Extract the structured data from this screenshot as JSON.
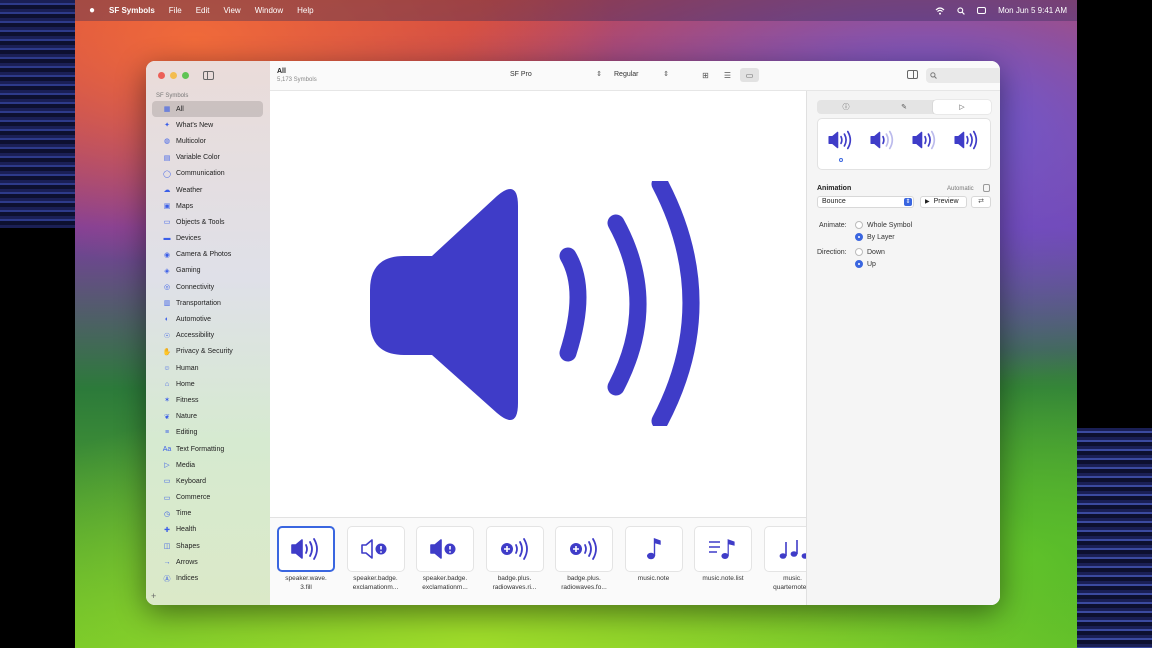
{
  "colors": {
    "accent": "#3a66e0",
    "symbol": "#3f3cc8"
  },
  "menubar": {
    "app_name": "SF Symbols",
    "menus": [
      "File",
      "Edit",
      "View",
      "Window",
      "Help"
    ],
    "clock": "Mon Jun 5  9:41 AM"
  },
  "sidebar": {
    "section": "SF Symbols",
    "items": [
      {
        "label": "All",
        "icon": "grid-icon"
      },
      {
        "label": "What's New",
        "icon": "sparkle-icon"
      },
      {
        "label": "Multicolor",
        "icon": "palette-icon"
      },
      {
        "label": "Variable Color",
        "icon": "slider-icon"
      },
      {
        "label": "Communication",
        "icon": "bubble-icon"
      },
      {
        "label": "Weather",
        "icon": "cloud-icon"
      },
      {
        "label": "Maps",
        "icon": "map-icon"
      },
      {
        "label": "Objects & Tools",
        "icon": "folder-icon"
      },
      {
        "label": "Devices",
        "icon": "display-icon"
      },
      {
        "label": "Camera & Photos",
        "icon": "camera-icon"
      },
      {
        "label": "Gaming",
        "icon": "gamecontroller-icon"
      },
      {
        "label": "Connectivity",
        "icon": "antenna-icon"
      },
      {
        "label": "Transportation",
        "icon": "car-icon"
      },
      {
        "label": "Automotive",
        "icon": "steering-icon"
      },
      {
        "label": "Accessibility",
        "icon": "accessibility-icon"
      },
      {
        "label": "Privacy & Security",
        "icon": "lock-icon"
      },
      {
        "label": "Human",
        "icon": "person-icon"
      },
      {
        "label": "Home",
        "icon": "house-icon"
      },
      {
        "label": "Fitness",
        "icon": "figure-run-icon"
      },
      {
        "label": "Nature",
        "icon": "leaf-icon"
      },
      {
        "label": "Editing",
        "icon": "slider-lines-icon"
      },
      {
        "label": "Text Formatting",
        "icon": "text-icon"
      },
      {
        "label": "Media",
        "icon": "play-icon"
      },
      {
        "label": "Keyboard",
        "icon": "keyboard-icon"
      },
      {
        "label": "Commerce",
        "icon": "cart-icon"
      },
      {
        "label": "Time",
        "icon": "clock-icon"
      },
      {
        "label": "Health",
        "icon": "heart-icon"
      },
      {
        "label": "Shapes",
        "icon": "shapes-icon"
      },
      {
        "label": "Arrows",
        "icon": "arrow-icon"
      },
      {
        "label": "Indices",
        "icon": "circle-a-icon"
      }
    ]
  },
  "toolbar": {
    "title": "All",
    "subtitle": "5,173 Symbols",
    "font": "SF Pro",
    "weight": "Regular"
  },
  "symbols": [
    {
      "label": "speaker.wave.\n3.fill",
      "icon": "speaker-wave-3-fill-icon",
      "selected": true
    },
    {
      "label": "speaker.badge.\nexclamationm...",
      "icon": "speaker-badge-exclamation-icon"
    },
    {
      "label": "speaker.badge.\nexclamationm...",
      "icon": "speaker-badge-exclamation-fill-icon"
    },
    {
      "label": "badge.plus.\nradiowaves.ri...",
      "icon": "badge-plus-radiowaves-right-icon"
    },
    {
      "label": "badge.plus.\nradiowaves.fo...",
      "icon": "badge-plus-radiowaves-forward-icon"
    },
    {
      "label": "music.note",
      "icon": "music-note-icon"
    },
    {
      "label": "music.note.list",
      "icon": "music-note-list-icon"
    },
    {
      "label": "music.\nquarternote...",
      "icon": "music-quarternote-icon"
    }
  ],
  "inspector": {
    "animation_label": "Animation",
    "automatic_label": "Automatic",
    "effect": "Bounce",
    "preview_label": "Preview",
    "animate_label": "Animate:",
    "animate_options": [
      "Whole Symbol",
      "By Layer"
    ],
    "animate_selected": "By Layer",
    "direction_label": "Direction:",
    "direction_options": [
      "Down",
      "Up"
    ],
    "direction_selected": "Up"
  }
}
